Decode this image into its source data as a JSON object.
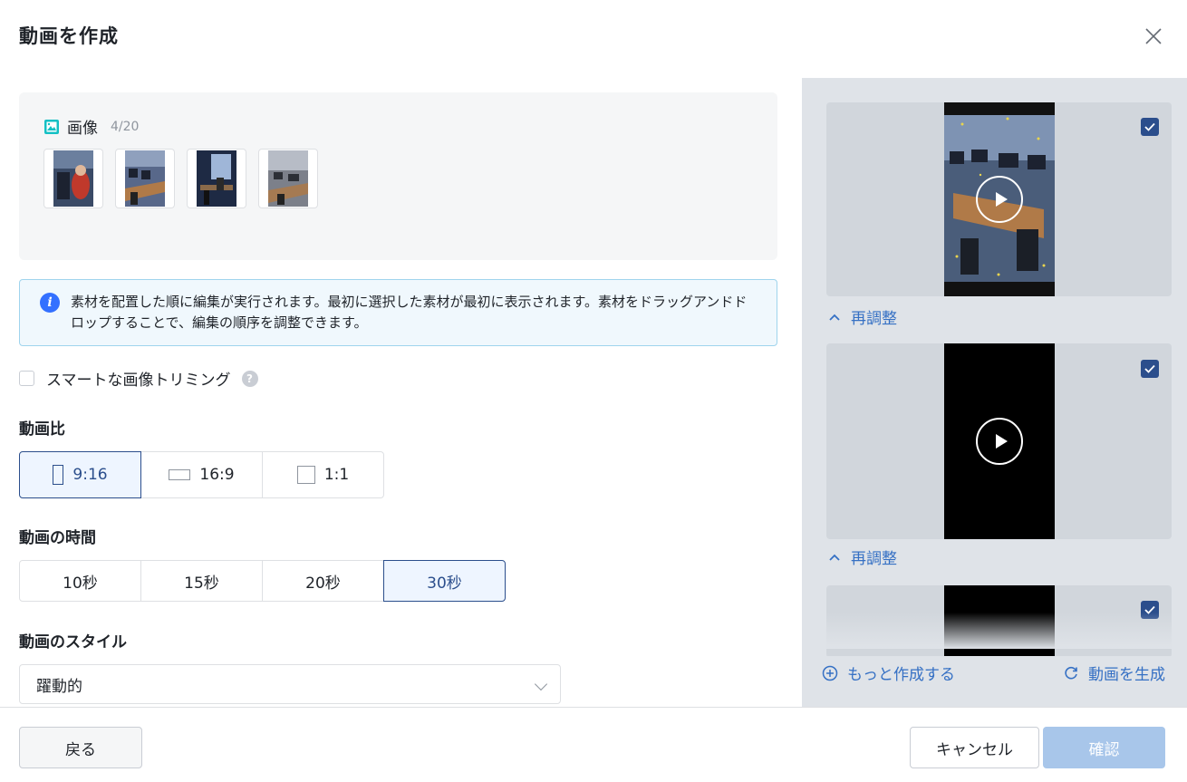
{
  "dialog": {
    "title": "動画を作成",
    "close_icon": "close-icon"
  },
  "images": {
    "label": "画像",
    "count": "4/20",
    "icon": "image-icon",
    "thumbs": [
      "office-photo-1",
      "office-photo-2",
      "office-photo-3",
      "office-photo-4"
    ]
  },
  "info": {
    "icon": "info-icon",
    "text": "素材を配置した順に編集が実行されます。最初に選択した素材が最初に表示されます。素材をドラッグアンドドロップすることで、編集の順序を調整できます。"
  },
  "smart_trim": {
    "label": "スマートな画像トリミング",
    "checked": false,
    "help_icon": "question-icon"
  },
  "ratio": {
    "label": "動画比",
    "options": [
      {
        "label": "9:16",
        "active": true
      },
      {
        "label": "16:9",
        "active": false
      },
      {
        "label": "1:1",
        "active": false
      }
    ]
  },
  "duration": {
    "label": "動画の時間",
    "options": [
      {
        "label": "10秒",
        "active": false
      },
      {
        "label": "15秒",
        "active": false
      },
      {
        "label": "20秒",
        "active": false
      },
      {
        "label": "30秒",
        "active": true
      }
    ]
  },
  "style": {
    "label": "動画のスタイル",
    "value": "躍動的"
  },
  "previews": {
    "readjust_label": "再調整",
    "items": [
      {
        "checked": true,
        "thumbnail": "office-video-frame"
      },
      {
        "checked": true,
        "thumbnail": "black-video-frame"
      },
      {
        "checked": true,
        "thumbnail": "black-video-frame"
      }
    ],
    "more_label": "もっと作成する",
    "generate_label": "動画を生成"
  },
  "footer": {
    "back_label": "戻る",
    "cancel_label": "キャンセル",
    "confirm_label": "確認"
  },
  "colors": {
    "accent": "#2b4e8c",
    "link": "#3570c4",
    "confirm_disabled": "#a8c6ea"
  }
}
